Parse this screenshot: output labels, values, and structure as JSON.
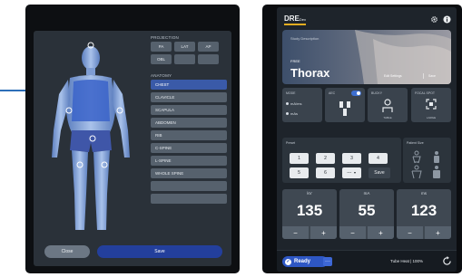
{
  "left_panel": {
    "projection": {
      "title": "PROJECTION",
      "buttons": [
        "PA",
        "LAT",
        "AP",
        "OBL",
        "",
        ""
      ]
    },
    "anatomy": {
      "title": "ANATOMY",
      "items": [
        "CHEST",
        "CLAVICLE",
        "SCAPULA",
        "ABDOMEN",
        "RIB",
        "C-SPINE",
        "L-SPINE",
        "WHOLE SPINE",
        "",
        ""
      ],
      "active": "CHEST"
    },
    "close_label": "Close",
    "save_label": "Save",
    "body_icon": "human-body-model"
  },
  "right_panel": {
    "logo": {
      "main": "DRE",
      "sub": "Dex"
    },
    "header_icons": [
      "gear-icon",
      "info-icon"
    ],
    "study": {
      "description_label": "Study Description",
      "free_label": "FREE",
      "title": "Thorax",
      "edit_settings": "Edit Settings",
      "save": "Save"
    },
    "tiles": {
      "mode": {
        "title": "MODE",
        "opt1": "mA/ms",
        "opt2": "mAs"
      },
      "aec": {
        "title": "AEC",
        "toggle": "on"
      },
      "bucky": {
        "title": "BUCKY",
        "value": "TABLE"
      },
      "focal_spot": {
        "title": "FOCAL SPOT",
        "value": "LARGE"
      }
    },
    "preset": {
      "title": "Preset",
      "buttons": [
        "1",
        "2",
        "3",
        "4",
        "5",
        "6"
      ],
      "dropdown": "---",
      "save": "Save"
    },
    "patient_size": {
      "title": "Patient Size"
    },
    "exposure": [
      {
        "label": "kV",
        "value": "135",
        "minus": "−",
        "plus": "+"
      },
      {
        "label": "mA",
        "value": "55",
        "minus": "−",
        "plus": "+"
      },
      {
        "label": "ms",
        "value": "123",
        "minus": "−",
        "plus": "+"
      }
    ],
    "status": {
      "ready": "Ready",
      "more": "···",
      "tube_heat": "Tube Heat  |  100%"
    }
  },
  "colors": {
    "accent_blue": "#2e57c4",
    "active_item": "#3a5aa8",
    "logo_bar": "#e4ad20"
  }
}
